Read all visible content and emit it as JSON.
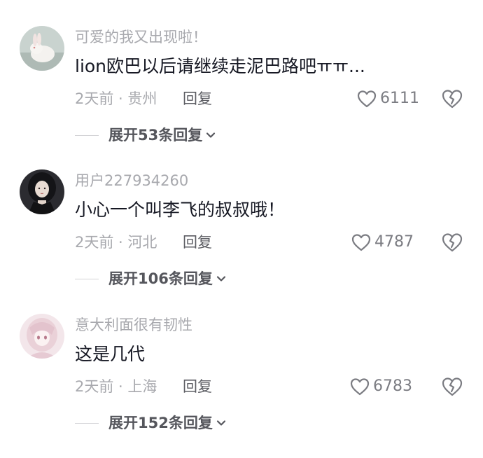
{
  "comments": [
    {
      "username": "可爱的我又出现啦！",
      "text": "lion欧巴以后请继续走泥巴路吧ㅠㅠ...",
      "meta": "2天前 · 贵州",
      "reply_label": "回复",
      "likes": "6111",
      "expand_label": "展开53条回复",
      "avatar_icon": "white-rabbit-avatar"
    },
    {
      "username": "用户227934260",
      "text": "小心一个叫李飞的叔叔哦！",
      "meta": "2天前 · 河北",
      "reply_label": "回复",
      "likes": "4787",
      "expand_label": "展开106条回复",
      "avatar_icon": "dark-haired-girl-avatar"
    },
    {
      "username": "意大利面很有韧性",
      "text": "这是几代",
      "meta": "2天前 · 上海",
      "reply_label": "回复",
      "likes": "6783",
      "expand_label": "展开152条回复",
      "avatar_icon": "pink-anime-girl-avatar"
    }
  ],
  "icons": {
    "like": "heart-outline-icon",
    "dislike": "broken-heart-icon",
    "expand": "chevron-down-icon"
  },
  "colors": {
    "username": "#a8a9ae",
    "text": "#161823",
    "meta": "#a8a9ae",
    "reply": "#5c5d63",
    "icon": "#7b7c82"
  }
}
